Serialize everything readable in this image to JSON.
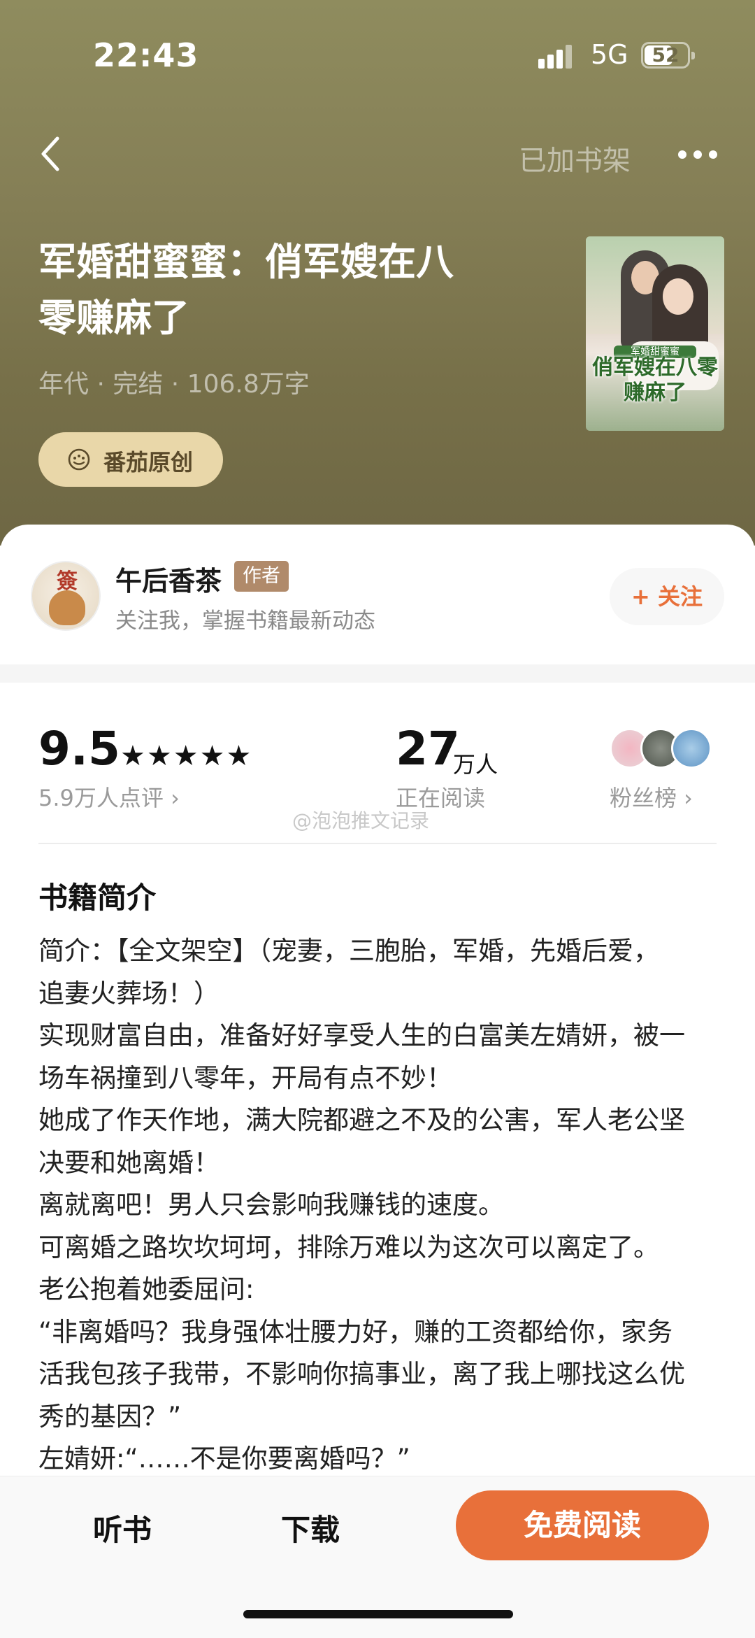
{
  "status_bar": {
    "time": "22:43",
    "network": "5G",
    "battery": "52"
  },
  "header": {
    "back_label": "back",
    "shelf_label": "已加书架"
  },
  "book": {
    "title_line1": "军婚甜蜜蜜：俏军嫂在八",
    "title_line2": "零赚麻了",
    "meta": "年代 · 完结 · 106.8万字",
    "origin_badge": "番茄原创",
    "cover_sub": "军婚甜蜜蜜",
    "cover_title": "俏军嫂在八零赚麻了"
  },
  "author": {
    "name": "午后香茶",
    "tag": "作者",
    "desc": "关注我，掌握书籍最新动态",
    "follow_label": "+ 关注",
    "avatar_stamp": "簽"
  },
  "stats": {
    "rating": "9.5",
    "stars": 5,
    "review_count": "5.9万人点评 ›",
    "readers": "27",
    "readers_unit": "万人",
    "readers_label": "正在阅读",
    "fans_label": "粉丝榜 ›"
  },
  "watermark": "@泡泡推文记录",
  "intro": {
    "title": "书籍简介",
    "lines": [
      "简介：【全文架空】（宠妻，三胞胎，军婚，先婚后爱，",
      "追妻火葬场！）",
      "实现财富自由，准备好好享受人生的白富美左婧妍，被一",
      "场车祸撞到八零年，开局有点不妙！",
      "她成了作天作地，满大院都避之不及的公害，军人老公坚",
      "决要和她离婚！",
      "离就离吧！男人只会影响我赚钱的速度。",
      "可离婚之路坎坎坷坷，排除万难以为这次可以离定了。",
      "老公抱着她委屈问:",
      "“非离婚吗？我身强体壮腰力好，赚的工资都给你，家务",
      "活我包孩子我带，不影响你搞事业，离了我上哪找这么优",
      "秀的基因？”",
      "左婧妍:“……不是你要离婚吗？”"
    ]
  },
  "bottom_bar": {
    "listen": "听书",
    "download": "下载",
    "read": "免费阅读"
  },
  "colors": {
    "accent": "#e8703a",
    "hero": "#857f56",
    "badge": "#e9d7a9"
  }
}
